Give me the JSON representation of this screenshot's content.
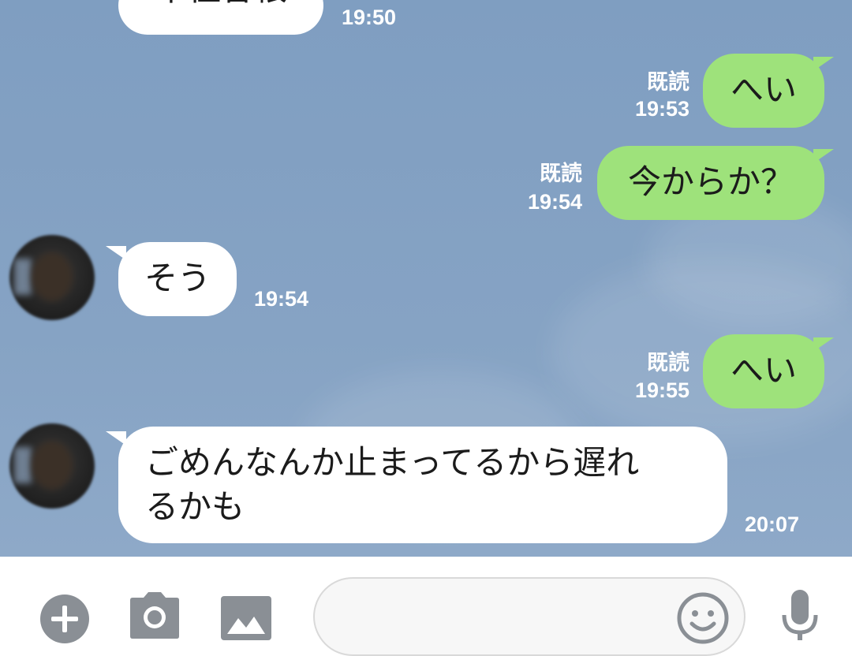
{
  "messages": [
    {
      "id": 1,
      "side": "in",
      "text": "千住曽根",
      "time": "19:50"
    },
    {
      "id": 2,
      "side": "out",
      "text": "へい",
      "read": "既読",
      "time": "19:53"
    },
    {
      "id": 3,
      "side": "out",
      "text": "今からか？",
      "read": "既読",
      "time": "19:54"
    },
    {
      "id": 4,
      "side": "in",
      "text": "そう",
      "time": "19:54"
    },
    {
      "id": 5,
      "side": "out",
      "text": "へい",
      "read": "既読",
      "time": "19:55"
    },
    {
      "id": 6,
      "side": "in",
      "text_line1": "ごめんなんか止まってるから遅れ",
      "text_line2": "るかも",
      "time": "20:07"
    }
  ],
  "input": {
    "placeholder": ""
  },
  "icons": {
    "add": "plus-circle-icon",
    "camera": "camera-icon",
    "image": "image-icon",
    "emoji": "smiley-icon",
    "mic": "microphone-icon"
  },
  "colors": {
    "chat_background": "#7f9ec1",
    "outgoing_bubble": "#9ee27b",
    "incoming_bubble": "#ffffff",
    "meta_text": "#ffffff",
    "toolbar_icon": "#8a8f95"
  }
}
